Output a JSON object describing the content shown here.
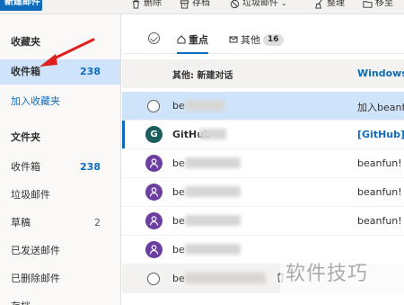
{
  "toolbar": {
    "new_mail": "新建邮件",
    "delete": "删除",
    "archive": "存档",
    "junk": "垃圾邮件",
    "sweep": "整理",
    "move": "移至"
  },
  "sidebar": {
    "favorites_header": "收藏夹",
    "favorites": [
      {
        "label": "收件箱",
        "count": "238"
      }
    ],
    "add_favorite": "加入收藏夹",
    "folders_header": "文件夹",
    "folders": [
      {
        "label": "收件箱",
        "count": "238"
      },
      {
        "label": "垃圾邮件",
        "count": ""
      },
      {
        "label": "草稿",
        "count": "2"
      },
      {
        "label": "已发送邮件",
        "count": ""
      },
      {
        "label": "已删除邮件",
        "count": ""
      },
      {
        "label": "存档",
        "count": ""
      }
    ]
  },
  "list": {
    "tabs": [
      {
        "label": "重点",
        "badge": ""
      },
      {
        "label": "其他",
        "badge": "16"
      }
    ],
    "other_group": {
      "label": "其他: 新建对话",
      "subject": "Windows"
    },
    "messages": [
      {
        "sender": "be",
        "subject": "加入beanf",
        "avatar": "",
        "avatar_color": ""
      },
      {
        "sender": "GitHub",
        "subject": "[GitHub]",
        "avatar": "G",
        "avatar_color": "#1b5e5e"
      },
      {
        "sender": "be",
        "subject": "beanfun!",
        "avatar": "person",
        "avatar_color": "#6b3fa0"
      },
      {
        "sender": "be",
        "subject": "beanfun!",
        "avatar": "person",
        "avatar_color": "#6b3fa0"
      },
      {
        "sender": "be",
        "subject": "beanfun!",
        "avatar": "person",
        "avatar_color": "#6b3fa0"
      },
      {
        "sender": "be",
        "subject": "",
        "avatar": "person",
        "avatar_color": "#6b3fa0"
      },
      {
        "sender": "be",
        "subject": "",
        "avatar": "",
        "avatar_color": ""
      }
    ]
  },
  "watermark": "软件技巧",
  "colors": {
    "accent": "#0f6cbd",
    "selected": "#cfe4fa",
    "arrow": "#e02020"
  }
}
